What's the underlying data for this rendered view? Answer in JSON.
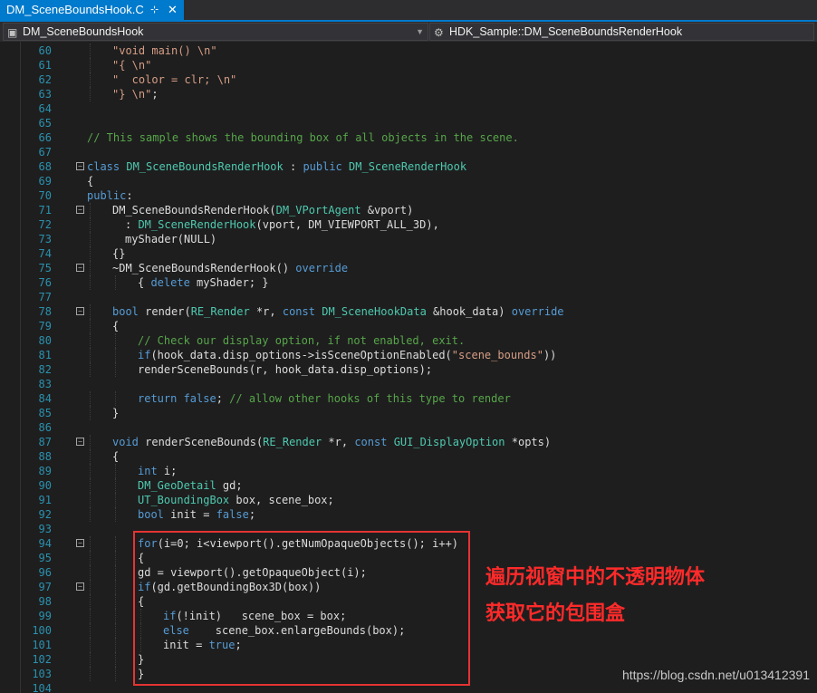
{
  "tab": {
    "title": "DM_SceneBoundsHook.C",
    "pin_icon": "⊹",
    "close_icon": "✕"
  },
  "nav": {
    "left_combo": "DM_SceneBoundsHook",
    "right_combo": "HDK_Sample::DM_SceneBoundsRenderHook"
  },
  "colors": {
    "keyword": "#569cd6",
    "type": "#4ec9b0",
    "string": "#d69d85",
    "comment": "#57a64a",
    "default": "#dcdcdc",
    "line_number": "#2b91af",
    "annotation": "#ff2a2a"
  },
  "code_lines": [
    {
      "n": "60",
      "i": 4,
      "t": [
        [
          "\"void main() \\n\"",
          "s"
        ]
      ]
    },
    {
      "n": "61",
      "i": 4,
      "t": [
        [
          "\"{ \\n\"",
          "s"
        ]
      ]
    },
    {
      "n": "62",
      "i": 4,
      "t": [
        [
          "\"  color = clr; \\n\"",
          "s"
        ]
      ]
    },
    {
      "n": "63",
      "i": 4,
      "t": [
        [
          "\"} \\n\"",
          "s"
        ],
        [
          ";",
          "d"
        ]
      ]
    },
    {
      "n": "64",
      "i": 0,
      "t": []
    },
    {
      "n": "65",
      "i": 0,
      "t": []
    },
    {
      "n": "66",
      "i": 0,
      "t": [
        [
          "// This sample shows the bounding box of all objects in the scene.",
          "c"
        ]
      ]
    },
    {
      "n": "67",
      "i": 0,
      "t": []
    },
    {
      "n": "68",
      "i": 0,
      "f": "−",
      "t": [
        [
          "class ",
          "k"
        ],
        [
          "DM_SceneBoundsRenderHook",
          "y"
        ],
        [
          " : ",
          "d"
        ],
        [
          "public ",
          "k"
        ],
        [
          "DM_SceneRenderHook",
          "y"
        ]
      ]
    },
    {
      "n": "69",
      "i": 0,
      "t": [
        [
          "{",
          "d"
        ]
      ]
    },
    {
      "n": "70",
      "i": 0,
      "t": [
        [
          "public",
          "k"
        ],
        [
          ":",
          "d"
        ]
      ]
    },
    {
      "n": "71",
      "i": 4,
      "f": "−",
      "t": [
        [
          "DM_SceneBoundsRenderHook",
          "d"
        ],
        [
          "(",
          "d"
        ],
        [
          "DM_VPortAgent",
          "y"
        ],
        [
          " &vport)",
          "d"
        ]
      ]
    },
    {
      "n": "72",
      "i": 6,
      "t": [
        [
          ": ",
          "d"
        ],
        [
          "DM_SceneRenderHook",
          "y"
        ],
        [
          "(vport, ",
          "d"
        ],
        [
          "DM_VIEWPORT_ALL_3D",
          "d"
        ],
        [
          "),",
          "d"
        ]
      ]
    },
    {
      "n": "73",
      "i": 6,
      "t": [
        [
          "myShader(NULL)",
          "d"
        ]
      ]
    },
    {
      "n": "74",
      "i": 4,
      "t": [
        [
          "{}",
          "d"
        ]
      ]
    },
    {
      "n": "75",
      "i": 4,
      "f": "−",
      "t": [
        [
          "~DM_SceneBoundsRenderHook() ",
          "d"
        ],
        [
          "override",
          "k"
        ]
      ]
    },
    {
      "n": "76",
      "i": 8,
      "t": [
        [
          "{ ",
          "d"
        ],
        [
          "delete ",
          "k"
        ],
        [
          "myShader; }",
          "d"
        ]
      ]
    },
    {
      "n": "77",
      "i": 0,
      "t": []
    },
    {
      "n": "78",
      "i": 4,
      "f": "−",
      "t": [
        [
          "bool ",
          "k"
        ],
        [
          "render(",
          "d"
        ],
        [
          "RE_Render",
          "y"
        ],
        [
          " *r, ",
          "d"
        ],
        [
          "const ",
          "k"
        ],
        [
          "DM_SceneHookData",
          "y"
        ],
        [
          " &hook_data) ",
          "d"
        ],
        [
          "override",
          "k"
        ]
      ]
    },
    {
      "n": "79",
      "i": 4,
      "t": [
        [
          "{",
          "d"
        ]
      ]
    },
    {
      "n": "80",
      "i": 8,
      "t": [
        [
          "// Check our display option, if not enabled, exit.",
          "c"
        ]
      ]
    },
    {
      "n": "81",
      "i": 8,
      "t": [
        [
          "if",
          "k"
        ],
        [
          "(hook_data.disp_options->isSceneOptionEnabled(",
          "d"
        ],
        [
          "\"scene_bounds\"",
          "s"
        ],
        [
          "))",
          "d"
        ]
      ]
    },
    {
      "n": "82",
      "i": 8,
      "t": [
        [
          "renderSceneBounds(r, hook_data.disp_options);",
          "d"
        ]
      ]
    },
    {
      "n": "83",
      "i": 0,
      "t": []
    },
    {
      "n": "84",
      "i": 8,
      "t": [
        [
          "return ",
          "k"
        ],
        [
          "false",
          "k"
        ],
        [
          "; ",
          "d"
        ],
        [
          "// allow other hooks of this type to render",
          "c"
        ]
      ]
    },
    {
      "n": "85",
      "i": 4,
      "t": [
        [
          "}",
          "d"
        ]
      ]
    },
    {
      "n": "86",
      "i": 0,
      "t": []
    },
    {
      "n": "87",
      "i": 4,
      "f": "−",
      "t": [
        [
          "void ",
          "k"
        ],
        [
          "renderSceneBounds(",
          "d"
        ],
        [
          "RE_Render",
          "y"
        ],
        [
          " *r, ",
          "d"
        ],
        [
          "const ",
          "k"
        ],
        [
          "GUI_DisplayOption",
          "y"
        ],
        [
          " *opts)",
          "d"
        ]
      ]
    },
    {
      "n": "88",
      "i": 4,
      "t": [
        [
          "{",
          "d"
        ]
      ]
    },
    {
      "n": "89",
      "i": 8,
      "t": [
        [
          "int ",
          "k"
        ],
        [
          "i;",
          "d"
        ]
      ]
    },
    {
      "n": "90",
      "i": 8,
      "t": [
        [
          "DM_GeoDetail",
          "y"
        ],
        [
          " gd;",
          "d"
        ]
      ]
    },
    {
      "n": "91",
      "i": 8,
      "t": [
        [
          "UT_BoundingBox",
          "y"
        ],
        [
          " box, scene_box;",
          "d"
        ]
      ]
    },
    {
      "n": "92",
      "i": 8,
      "t": [
        [
          "bool ",
          "k"
        ],
        [
          "init = ",
          "d"
        ],
        [
          "false",
          "k"
        ],
        [
          ";",
          "d"
        ]
      ]
    },
    {
      "n": "93",
      "i": 0,
      "t": []
    },
    {
      "n": "94",
      "i": 8,
      "f": "−",
      "t": [
        [
          "for",
          "k"
        ],
        [
          "(i=0; i<viewport().getNumOpaqueObjects(); i++)",
          "d"
        ]
      ]
    },
    {
      "n": "95",
      "i": 8,
      "t": [
        [
          "{",
          "d"
        ]
      ]
    },
    {
      "n": "96",
      "i": 8,
      "t": [
        [
          "gd = viewport().getOpaqueObject(i);",
          "d"
        ]
      ]
    },
    {
      "n": "97",
      "i": 8,
      "f": "−",
      "t": [
        [
          "if",
          "k"
        ],
        [
          "(gd.getBoundingBox3D(box))",
          "d"
        ]
      ]
    },
    {
      "n": "98",
      "i": 8,
      "t": [
        [
          "{",
          "d"
        ]
      ]
    },
    {
      "n": "99",
      "i": 12,
      "t": [
        [
          "if",
          "k"
        ],
        [
          "(!init)   scene_box = box;",
          "d"
        ]
      ]
    },
    {
      "n": "100",
      "i": 12,
      "t": [
        [
          "else",
          "k"
        ],
        [
          "    scene_box.enlargeBounds(box);",
          "d"
        ]
      ]
    },
    {
      "n": "101",
      "i": 12,
      "t": [
        [
          "init = ",
          "d"
        ],
        [
          "true",
          "k"
        ],
        [
          ";",
          "d"
        ]
      ]
    },
    {
      "n": "102",
      "i": 8,
      "t": [
        [
          "}",
          "d"
        ]
      ]
    },
    {
      "n": "103",
      "i": 8,
      "t": [
        [
          "}",
          "d"
        ]
      ]
    },
    {
      "n": "104",
      "i": 0,
      "t": []
    }
  ],
  "annotations": [
    "遍历视窗中的不透明物体",
    "获取它的包围盒"
  ],
  "watermark": "https://blog.csdn.net/u013412391"
}
